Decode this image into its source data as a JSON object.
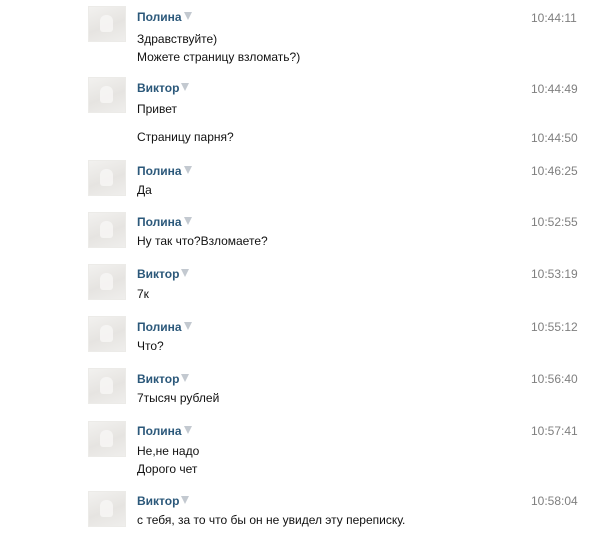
{
  "messages": [
    {
      "author": "Полина",
      "time": "10:44:11",
      "lines": [
        "Здравствуйте)",
        "Можете страницу взломать?)"
      ],
      "has_avatar": true
    },
    {
      "author": "Виктор",
      "time": "10:44:49",
      "lines": [
        "Привет"
      ],
      "has_avatar": true
    },
    {
      "author": "",
      "time": "10:44:50",
      "lines": [
        "Страницу парня?"
      ],
      "has_avatar": false
    },
    {
      "author": "Полина",
      "time": "10:46:25",
      "lines": [
        "Да"
      ],
      "has_avatar": true
    },
    {
      "author": "Полина",
      "time": "10:52:55",
      "lines": [
        "Ну так что?Взломаете?"
      ],
      "has_avatar": true
    },
    {
      "author": "Виктор",
      "time": "10:53:19",
      "lines": [
        "7к"
      ],
      "has_avatar": true
    },
    {
      "author": "Полина",
      "time": "10:55:12",
      "lines": [
        "Что?"
      ],
      "has_avatar": true
    },
    {
      "author": "Виктор",
      "time": "10:56:40",
      "lines": [
        "7тысяч рублей"
      ],
      "has_avatar": true
    },
    {
      "author": "Полина",
      "time": "10:57:41",
      "lines": [
        "Не,не надо",
        "Дорого чет"
      ],
      "has_avatar": true
    },
    {
      "author": "Виктор",
      "time": "10:58:04",
      "lines": [
        "с тебя, за то что бы он не увидел эту переписку."
      ],
      "has_avatar": true
    }
  ]
}
